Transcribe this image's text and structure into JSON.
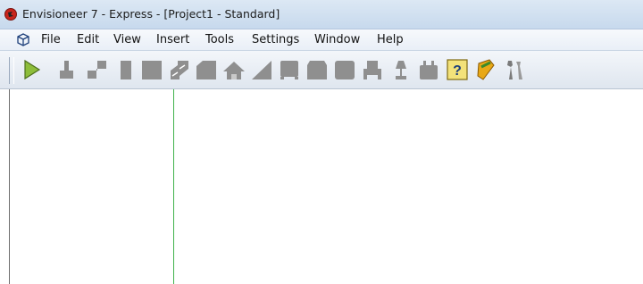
{
  "window": {
    "title": "Envisioneer 7 - Express - [Project1 - Standard]"
  },
  "menubar": {
    "items": [
      {
        "label": "File"
      },
      {
        "label": "Edit"
      },
      {
        "label": "View"
      },
      {
        "label": "Insert"
      },
      {
        "label": "Tools"
      },
      {
        "label": "Settings"
      },
      {
        "label": "Window"
      },
      {
        "label": "Help"
      }
    ]
  },
  "toolbar": {
    "tools": [
      {
        "icon": "select-arrow-icon"
      },
      {
        "icon": "wall-brush-icon"
      },
      {
        "icon": "wall-tool-icon"
      },
      {
        "icon": "door-icon"
      },
      {
        "icon": "window-icon"
      },
      {
        "icon": "stair-icon"
      },
      {
        "icon": "floor-icon"
      },
      {
        "icon": "roof-icon"
      },
      {
        "icon": "ramp-icon"
      },
      {
        "icon": "cabinet-icon"
      },
      {
        "icon": "appliance-icon"
      },
      {
        "icon": "fixture-icon"
      },
      {
        "icon": "chair-icon"
      },
      {
        "icon": "lamp-icon"
      },
      {
        "icon": "decor-icon"
      },
      {
        "icon": "help-icon"
      },
      {
        "icon": "book-icon"
      },
      {
        "icon": "tools-icon"
      }
    ]
  },
  "colors": {
    "title_bar": "#c7d9ed",
    "splitter": "#3fb24b",
    "tool_gray": "#8f8f8f",
    "select_arrow": "#7ea631"
  }
}
